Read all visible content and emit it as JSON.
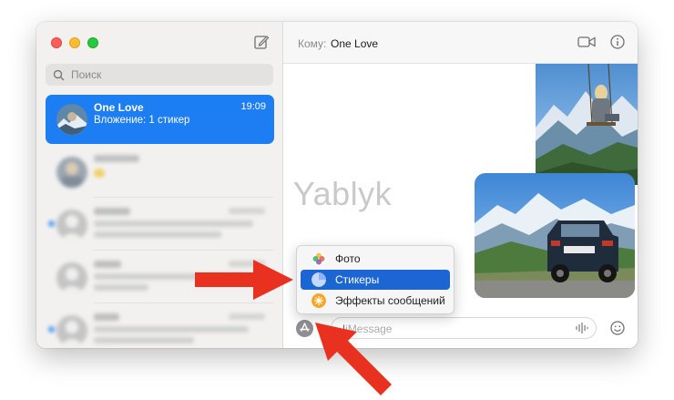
{
  "sidebar": {
    "search_placeholder": "Поиск",
    "active_conversation": {
      "name": "One Love",
      "time": "19:09",
      "preview": "Вложение: 1 стикер"
    }
  },
  "header": {
    "to_label": "Кому:",
    "recipient": "One Love"
  },
  "watermark": "Yablyk",
  "composer": {
    "placeholder": "iMessage"
  },
  "apps_menu": {
    "items": [
      {
        "label": "Фото"
      },
      {
        "label": "Стикеры"
      },
      {
        "label": "Эффекты сообщений"
      }
    ],
    "selected_index": 1
  },
  "colors": {
    "accent": "#1c7ef2",
    "menu_selected": "#1c66d4",
    "annotation_arrow": "#e8321f"
  }
}
